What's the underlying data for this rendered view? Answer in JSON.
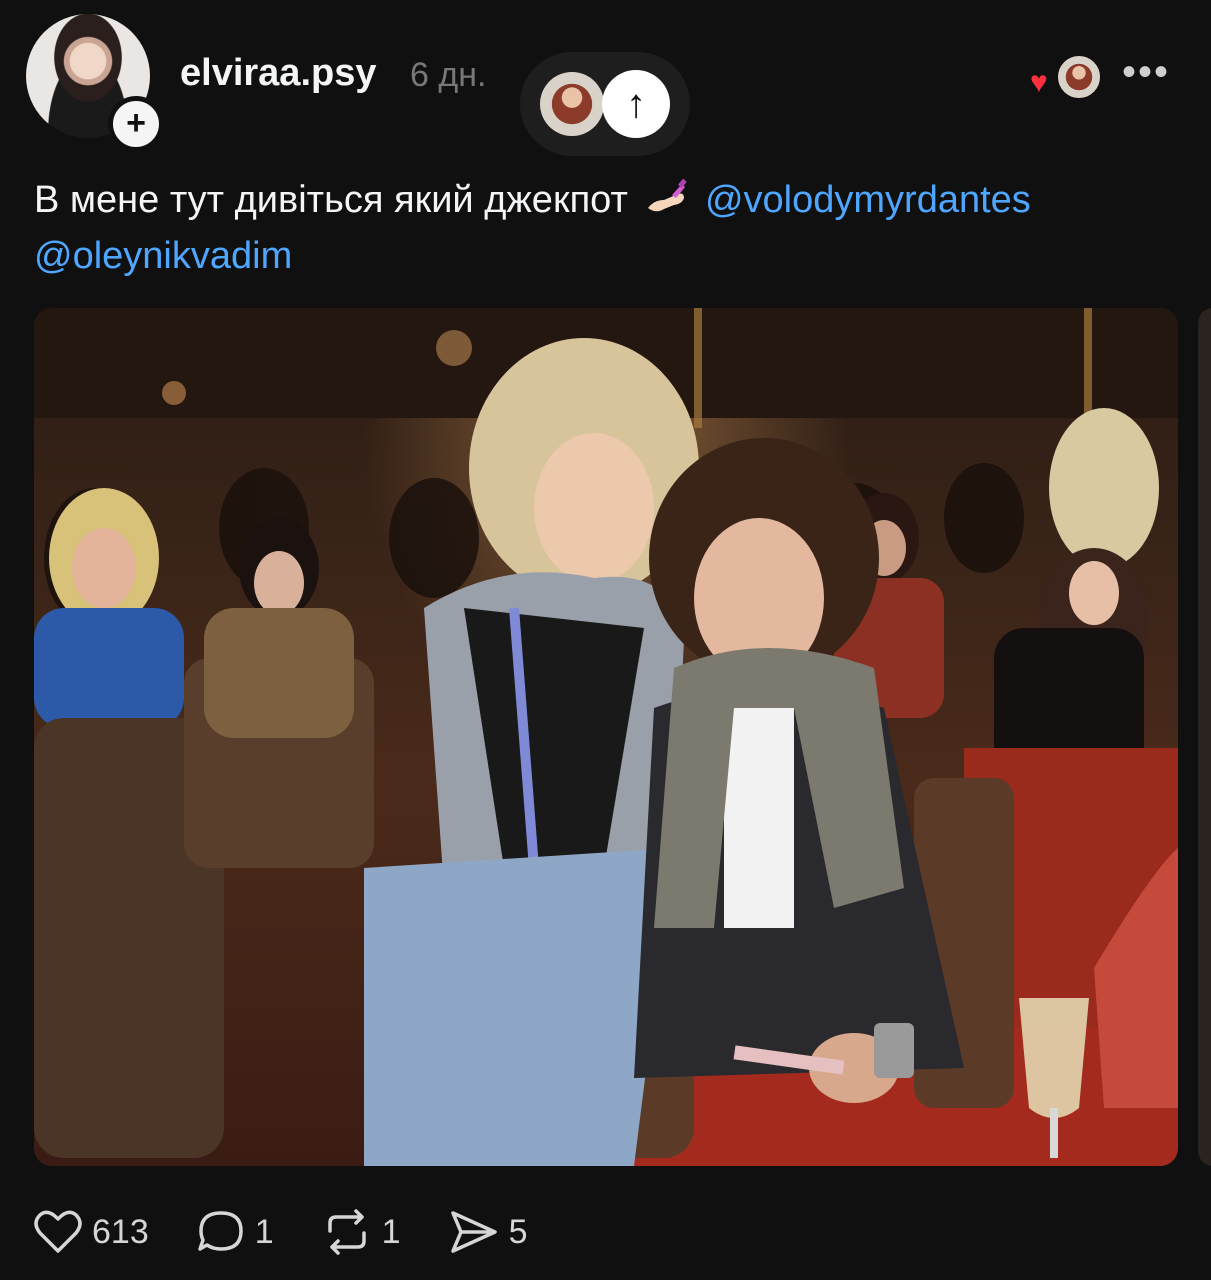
{
  "author": {
    "username": "elviraa.psy",
    "time": "6 дн.",
    "follow_symbol": "+"
  },
  "header": {
    "up_symbol": "↑",
    "liked_heart": "♥",
    "more_symbol": "•••"
  },
  "post": {
    "text_before": "В мене тут дивіться який джекпот",
    "emoji": "nail-polish-emoji",
    "mention_1": "@volodymyrdantes",
    "mention_2": "@oleynikvadim"
  },
  "actions": {
    "likes": "613",
    "comments": "1",
    "reposts": "1",
    "shares": "5"
  },
  "icons": {
    "like": "heart-outline-icon",
    "comment": "comment-bubble-icon",
    "repost": "repost-arrows-icon",
    "share": "send-paper-plane-icon"
  },
  "colors": {
    "background": "#101010",
    "text": "#f3f5f7",
    "mention": "#4ea6ff",
    "muted": "#777777",
    "heart": "#ff3040"
  }
}
